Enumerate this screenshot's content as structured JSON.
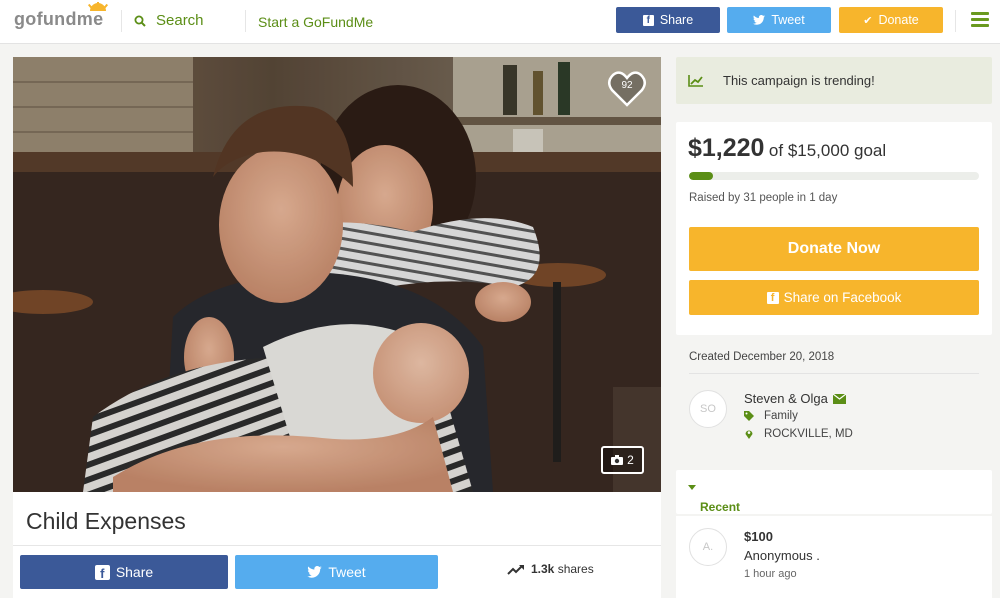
{
  "nav": {
    "logo": "gofundme",
    "search_label": "Search",
    "start_label": "Start a GoFundMe",
    "share_label": "Share",
    "tweet_label": "Tweet",
    "donate_label": "Donate"
  },
  "hero": {
    "likes": "92",
    "photo_count": "2"
  },
  "campaign": {
    "title": "Child Expenses",
    "share_label": "Share",
    "tweet_label": "Tweet",
    "shares_count": "1.3k",
    "shares_label": "shares"
  },
  "sidebar": {
    "trending_text": "This campaign is trending!",
    "raised_amount": "$1,220",
    "goal_text": "of $15,000 goal",
    "progress_fraction": 0.0813,
    "raised_by": "Raised by 31 people in 1 day",
    "donate_now": "Donate Now",
    "share_facebook": "Share on Facebook",
    "created": "Created December 20, 2018",
    "organizer": {
      "initials": "SO",
      "name": "Steven & Olga",
      "category": "Family",
      "location": "ROCKVILLE, MD"
    },
    "recent_donations_label": "Recent Donations",
    "donations": [
      {
        "initials": "A.",
        "amount": "$100",
        "name": "Anonymous .",
        "time": "1 hour ago"
      }
    ]
  },
  "colors": {
    "brand_green": "#5b8e16",
    "facebook": "#3b5998",
    "twitter": "#55acee",
    "donate_orange": "#f7b52c"
  }
}
